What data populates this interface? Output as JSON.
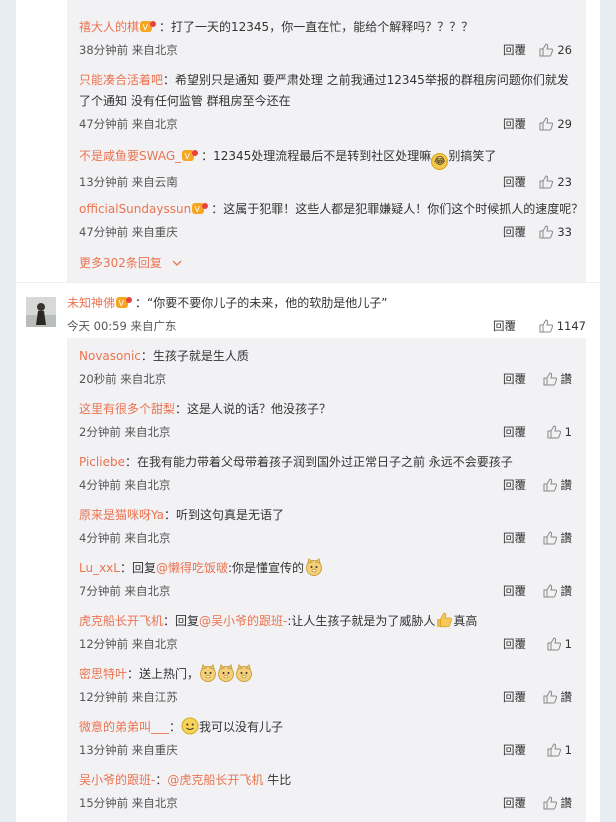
{
  "top_thread": {
    "replies": [
      {
        "user": "禧大人的棋",
        "vip": true,
        "text": "：打了一天的12345，你一直在忙，能给个解释吗？？？？",
        "text2": "",
        "time": "38分钟前 来自北京",
        "reply": "回覆",
        "likes": "26"
      },
      {
        "user": "只能凑合活着吧",
        "vip": false,
        "text": "：希望别只是通知 要严肃处理 之前我通过12345举报的群租房问题你们就发",
        "text2": "了个通知 没有任何监管 群租房至今还在",
        "time": "47分钟前 来自北京",
        "reply": "回覆",
        "likes": "29"
      },
      {
        "user": "不是咸鱼要SWAG_",
        "vip": true,
        "text": "：12345处理流程最后不是转到社区处理嘛",
        "emoji": "😂",
        "text_after": "别搞笑了",
        "time": "13分钟前 来自云南",
        "reply": "回覆",
        "likes": "23"
      },
      {
        "user": "officialSundayssun",
        "vip": true,
        "text": "：这属于犯罪！这些人都是犯罪嫌疑人！你们这个时候抓人的速度呢？",
        "text2": "",
        "time": "47分钟前 来自重庆",
        "reply": "回覆",
        "likes": "33"
      }
    ],
    "more_label": "更多302条回复"
  },
  "main_comment": {
    "user": "未知神佛",
    "text": "：“你要不要你儿子的未来，他的软肋是他儿子”",
    "time": "今天 00:59 来自广东",
    "reply": "回覆",
    "likes": "1147"
  },
  "sub_replies": [
    {
      "user": "Novasonic",
      "text": "：生孩子就是生人质",
      "time": "20秒前 来自北京",
      "reply": "回覆",
      "likes": "讚"
    },
    {
      "user": "这里有很多个甜梨",
      "text": "：这是人说的话？他没孩子？",
      "time": "2分钟前 来自北京",
      "reply": "回覆",
      "likes": "1"
    },
    {
      "user": "Picliebe",
      "text": "：在我有能力带着父母带着孩子润到国外过正常日子之前 永远不会要孩子",
      "time": "4分钟前 来自北京",
      "reply": "回覆",
      "likes": "讚"
    },
    {
      "user": "原来是猫咪呀Ya",
      "text": "：听到这句真是无语了",
      "time": "4分钟前 来自北京",
      "reply": "回覆",
      "likes": "讚"
    },
    {
      "user": "Lu_xxL",
      "text": "：回复",
      "mention": "@懒得吃饭啵",
      "text_after": ":你是懂宣传的",
      "time": "7分钟前 来自北京",
      "reply": "回覆",
      "likes": "讚"
    },
    {
      "user": "虎克船长开飞机",
      "text": "：回复",
      "mention": "@吴小爷的跟班-",
      "text_after": ":让人生孩子就是为了威胁人",
      "text_end": "真高",
      "time": "12分钟前 来自北京",
      "reply": "回覆",
      "likes": "1"
    },
    {
      "user": "密思特叶",
      "text": "：送上热门，",
      "time": "12分钟前 来自江苏",
      "reply": "回覆",
      "likes": "讚"
    },
    {
      "user": "微意的弟弟叫___",
      "text": "：",
      "text_after": "我可以没有儿子",
      "time": "13分钟前 来自重庆",
      "reply": "回覆",
      "likes": "1"
    },
    {
      "user": "吴小爷的跟班-",
      "text": "：",
      "mention": "@虎克船长开飞机",
      "text_after": " 牛比",
      "time": "15分钟前 来自北京",
      "reply": "回覆",
      "likes": "讚"
    }
  ],
  "colors": {
    "username": "#eb7350",
    "reply_bg": "#f2f2f5"
  }
}
